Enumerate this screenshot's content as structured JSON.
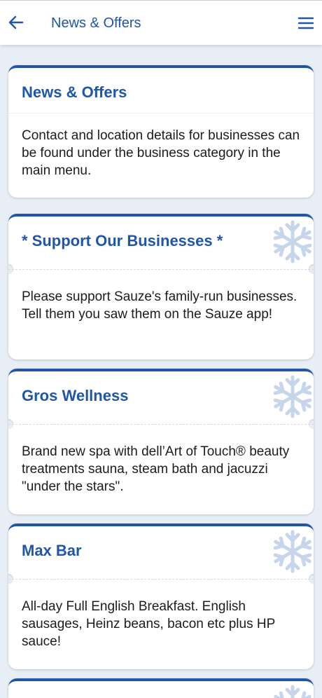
{
  "appbar": {
    "title": "News & Offers",
    "back_icon": "arrow-left-icon",
    "menu_icon": "hamburger-menu-icon"
  },
  "colors": {
    "accent": "#1f56a7",
    "background": "#e8eef6",
    "snowflake": "#c7d5ea"
  },
  "cards": [
    {
      "title": "News & Offers",
      "body": "Contact and location details for businesses can be found under the business category in the main menu."
    },
    {
      "title": "* Support Our Businesses *",
      "body": "Please support Sauze's family-run businesses. Tell them you saw them on the Sauze app!"
    },
    {
      "title": "Gros Wellness",
      "body": "Brand new spa with dell’Art of Touch® beauty treatments sauna, steam bath and jacuzzi \"under the stars\"."
    },
    {
      "title": "Max Bar",
      "body": "All-day Full English Breakfast. English sausages, Heinz beans, bacon etc plus HP sauce!"
    }
  ]
}
